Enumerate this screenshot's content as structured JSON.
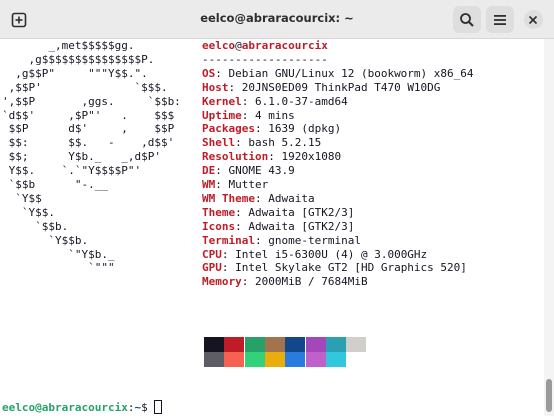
{
  "window": {
    "title": "eelco@abraracourcix: ~"
  },
  "titlebar": {
    "new_tab_icon": "plus-square-icon",
    "search_icon": "search-icon",
    "menu_icon": "hamburger-menu-icon",
    "close_icon": "close-icon"
  },
  "logo_lines": [
    "       _,met$$$$$gg.",
    "    ,g$$$$$$$$$$$$$$$P.",
    "  ,g$$P\"     \"\"\"Y$$.\".",
    " ,$$P'              `$$$.",
    "',$$P       ,ggs.     `$$b:",
    "`d$$'     ,$P\"'   .    $$$",
    " $$P      d$'     ,    $$P",
    " $$:      $$.   -    ,d$$'",
    " $$;      Y$b._   _,d$P'",
    " Y$$.    `.`\"Y$$$$P\"'",
    " `$$b      \"-.__",
    "  `Y$$",
    "   `Y$$.",
    "     `$$b.",
    "       `Y$$b.",
    "          `\"Y$b._",
    "             `\"\"\""
  ],
  "info": {
    "user": "eelco",
    "at": "@",
    "host": "abraracourcix",
    "separator": "-------------------",
    "fields": [
      {
        "label": "OS",
        "value": "Debian GNU/Linux 12 (bookworm) x86_64"
      },
      {
        "label": "Host",
        "value": "20JNS0ED09 ThinkPad T470 W10DG"
      },
      {
        "label": "Kernel",
        "value": "6.1.0-37-amd64"
      },
      {
        "label": "Uptime",
        "value": "4 mins"
      },
      {
        "label": "Packages",
        "value": "1639 (dpkg)"
      },
      {
        "label": "Shell",
        "value": "bash 5.2.15"
      },
      {
        "label": "Resolution",
        "value": "1920x1080"
      },
      {
        "label": "DE",
        "value": "GNOME 43.9"
      },
      {
        "label": "WM",
        "value": "Mutter"
      },
      {
        "label": "WM Theme",
        "value": "Adwaita"
      },
      {
        "label": "Theme",
        "value": "Adwaita [GTK2/3]"
      },
      {
        "label": "Icons",
        "value": "Adwaita [GTK2/3]"
      },
      {
        "label": "Terminal",
        "value": "gnome-terminal"
      },
      {
        "label": "CPU",
        "value": "Intel i5-6300U (4) @ 3.000GHz"
      },
      {
        "label": "GPU",
        "value": "Intel Skylake GT2 [HD Graphics 520]"
      },
      {
        "label": "Memory",
        "value": "2000MiB / 7684MiB"
      }
    ],
    "label_suffix": ":"
  },
  "palette": {
    "row1": [
      "#171421",
      "#c01c28",
      "#26a269",
      "#a2734c",
      "#12488b",
      "#a347ba",
      "#2aa1b3",
      "#d0cfcc"
    ],
    "row2": [
      "#5e5c64",
      "#f66151",
      "#33d17a",
      "#e9ad0c",
      "#2a7bde",
      "#c061cb",
      "#33c7de",
      "#ffffff"
    ]
  },
  "prompt": {
    "user_host": "eelco@abraracourcix",
    "colon": ":",
    "path": "~",
    "symbol": "$ "
  }
}
